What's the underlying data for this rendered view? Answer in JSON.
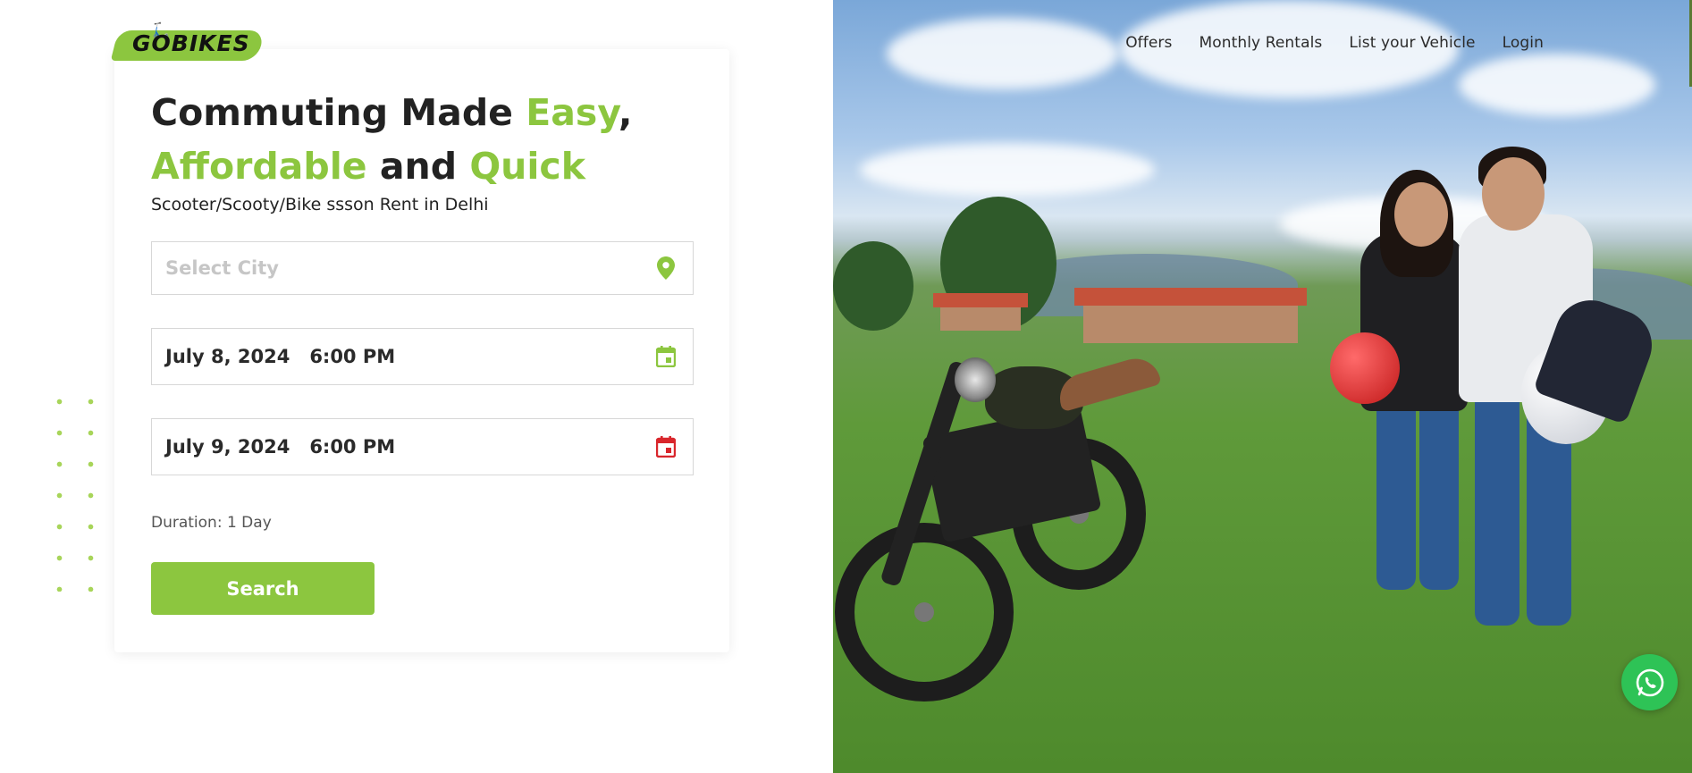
{
  "brand": {
    "logo_text": "GOBIKES",
    "accent_color": "#8cc63f"
  },
  "nav": {
    "items": [
      {
        "label": "Offers"
      },
      {
        "label": "Monthly Rentals"
      },
      {
        "label": "List your Vehicle"
      },
      {
        "label": "Login"
      }
    ]
  },
  "hero": {
    "headline_part1": "Commuting Made ",
    "headline_accent1": "Easy",
    "headline_comma": ",",
    "headline_accent2": "Affordable",
    "headline_and": " and ",
    "headline_accent3": "Quick",
    "subtitle": "Scooter/Scooty/Bike ssson Rent in Delhi"
  },
  "form": {
    "city_placeholder": "Select City",
    "start": {
      "date": "July 8, 2024",
      "time": "6:00 PM",
      "icon": "calendar-icon",
      "icon_color": "#8cc63f"
    },
    "end": {
      "date": "July 9, 2024",
      "time": "6:00 PM",
      "icon": "calendar-icon",
      "icon_color": "#d9262c"
    },
    "duration": "Duration: 1 Day",
    "search_label": "Search"
  },
  "widgets": {
    "whatsapp_icon": "whatsapp-icon"
  }
}
